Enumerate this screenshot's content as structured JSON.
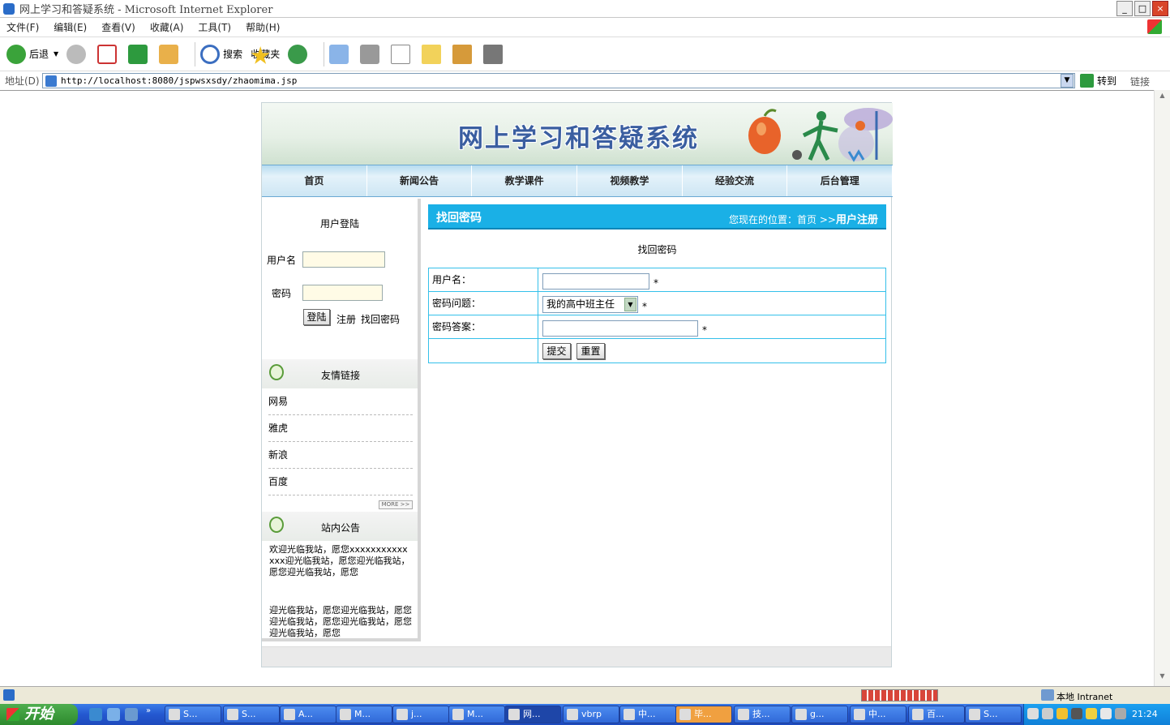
{
  "window": {
    "title": "网上学习和答疑系统 - Microsoft Internet Explorer",
    "buttons": [
      "_",
      "□",
      "×"
    ]
  },
  "menu": [
    "文件(F)",
    "编辑(E)",
    "查看(V)",
    "收藏(A)",
    "工具(T)",
    "帮助(H)"
  ],
  "toolbar": {
    "back_label": "后退",
    "search_label": "搜索",
    "favorites_label": "收藏夹"
  },
  "address": {
    "label": "地址(D)",
    "url": "http://localhost:8080/jspwsxsdy/zhaomima.jsp",
    "go_label": "转到",
    "links_label": "链接"
  },
  "site": {
    "title": "网上学习和答疑系统",
    "nav": [
      "首页",
      "新闻公告",
      "教学课件",
      "视频教学",
      "经验交流",
      "后台管理"
    ]
  },
  "login": {
    "title": "用户登陆",
    "username_label": "用户名",
    "password_label": "密码",
    "login_button": "登陆",
    "register_link": "注册",
    "find_password_link": "找回密码"
  },
  "friend_links": {
    "title": "友情链接",
    "items": [
      "网易",
      "雅虎",
      "新浪",
      "百度"
    ],
    "more": "MORE >>"
  },
  "notice": {
    "title": "站内公告",
    "paragraphs": [
      "欢迎光临我站，愿您xxxxxxxxxxxxxx迎光临我站，愿您迎光临我站，愿您迎光临我站，愿您",
      "迎光临我站，愿您迎光临我站，愿您迎光临我站，愿您迎光临我站，愿您迎光临我站，愿您"
    ]
  },
  "main": {
    "header": "找回密码",
    "location_prefix": "您现在的位置：首页 >>",
    "location_current": "用户注册",
    "subtitle": "找回密码",
    "username_label": "用户名：",
    "question_label": "密码问题：",
    "question_value": "我的高中班主任",
    "answer_label": "密码答案：",
    "required_mark": "*",
    "submit_button": "提交",
    "reset_button": "重置"
  },
  "statusbar": {
    "zone": "本地 Intranet"
  },
  "taskbar": {
    "start": "开始",
    "tasks": [
      "S...",
      "S...",
      "A...",
      "M...",
      "j...",
      "M...",
      "网...",
      "vbrp",
      "中...",
      "毕...",
      "技...",
      "g...",
      "中...",
      "百...",
      "S..."
    ],
    "clock": "21:24"
  }
}
